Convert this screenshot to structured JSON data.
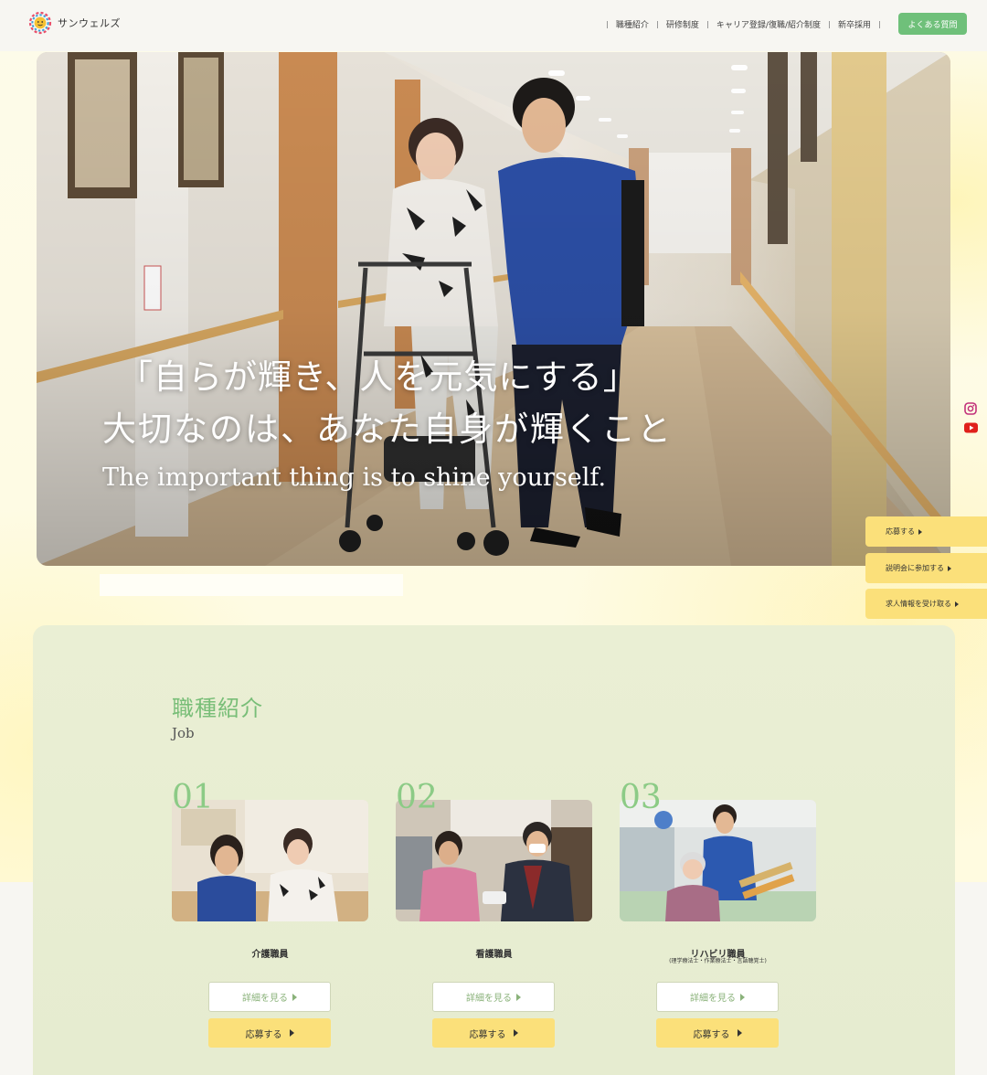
{
  "header": {
    "logo_text": "サンウェルズ",
    "nav": [
      "職種紹介",
      "研修制度",
      "キャリア登録/復職/紹介制度",
      "新卒採用"
    ],
    "faq_label": "よくある質問"
  },
  "hero": {
    "line1": "「自らが輝き、人を元気にする」",
    "line2": "大切なのは、あなた自身が輝くこと",
    "line_en": "The important thing is to shine yourself."
  },
  "social": {
    "icons": [
      "instagram-icon",
      "youtube-icon"
    ]
  },
  "floating_cta": [
    "応募する",
    "説明会に参加する",
    "求人情報を受け取る"
  ],
  "job_section": {
    "title": "職種紹介",
    "subtitle": "Job",
    "cards": [
      {
        "num": "01",
        "label": "介護職員",
        "note": "",
        "detail_label": "詳細を見る",
        "apply_label": "応募する"
      },
      {
        "num": "02",
        "label": "看護職員",
        "note": "",
        "detail_label": "詳細を見る",
        "apply_label": "応募する"
      },
      {
        "num": "03",
        "label": "リハビリ職員",
        "note": "(理学療法士・作業療法士・言語聴覚士)",
        "detail_label": "詳細を見る",
        "apply_label": "応募する"
      }
    ]
  },
  "colors": {
    "accent_green": "#6fc07a",
    "cta_yellow": "#fbe07a",
    "section_bg": "#e9eed3"
  }
}
